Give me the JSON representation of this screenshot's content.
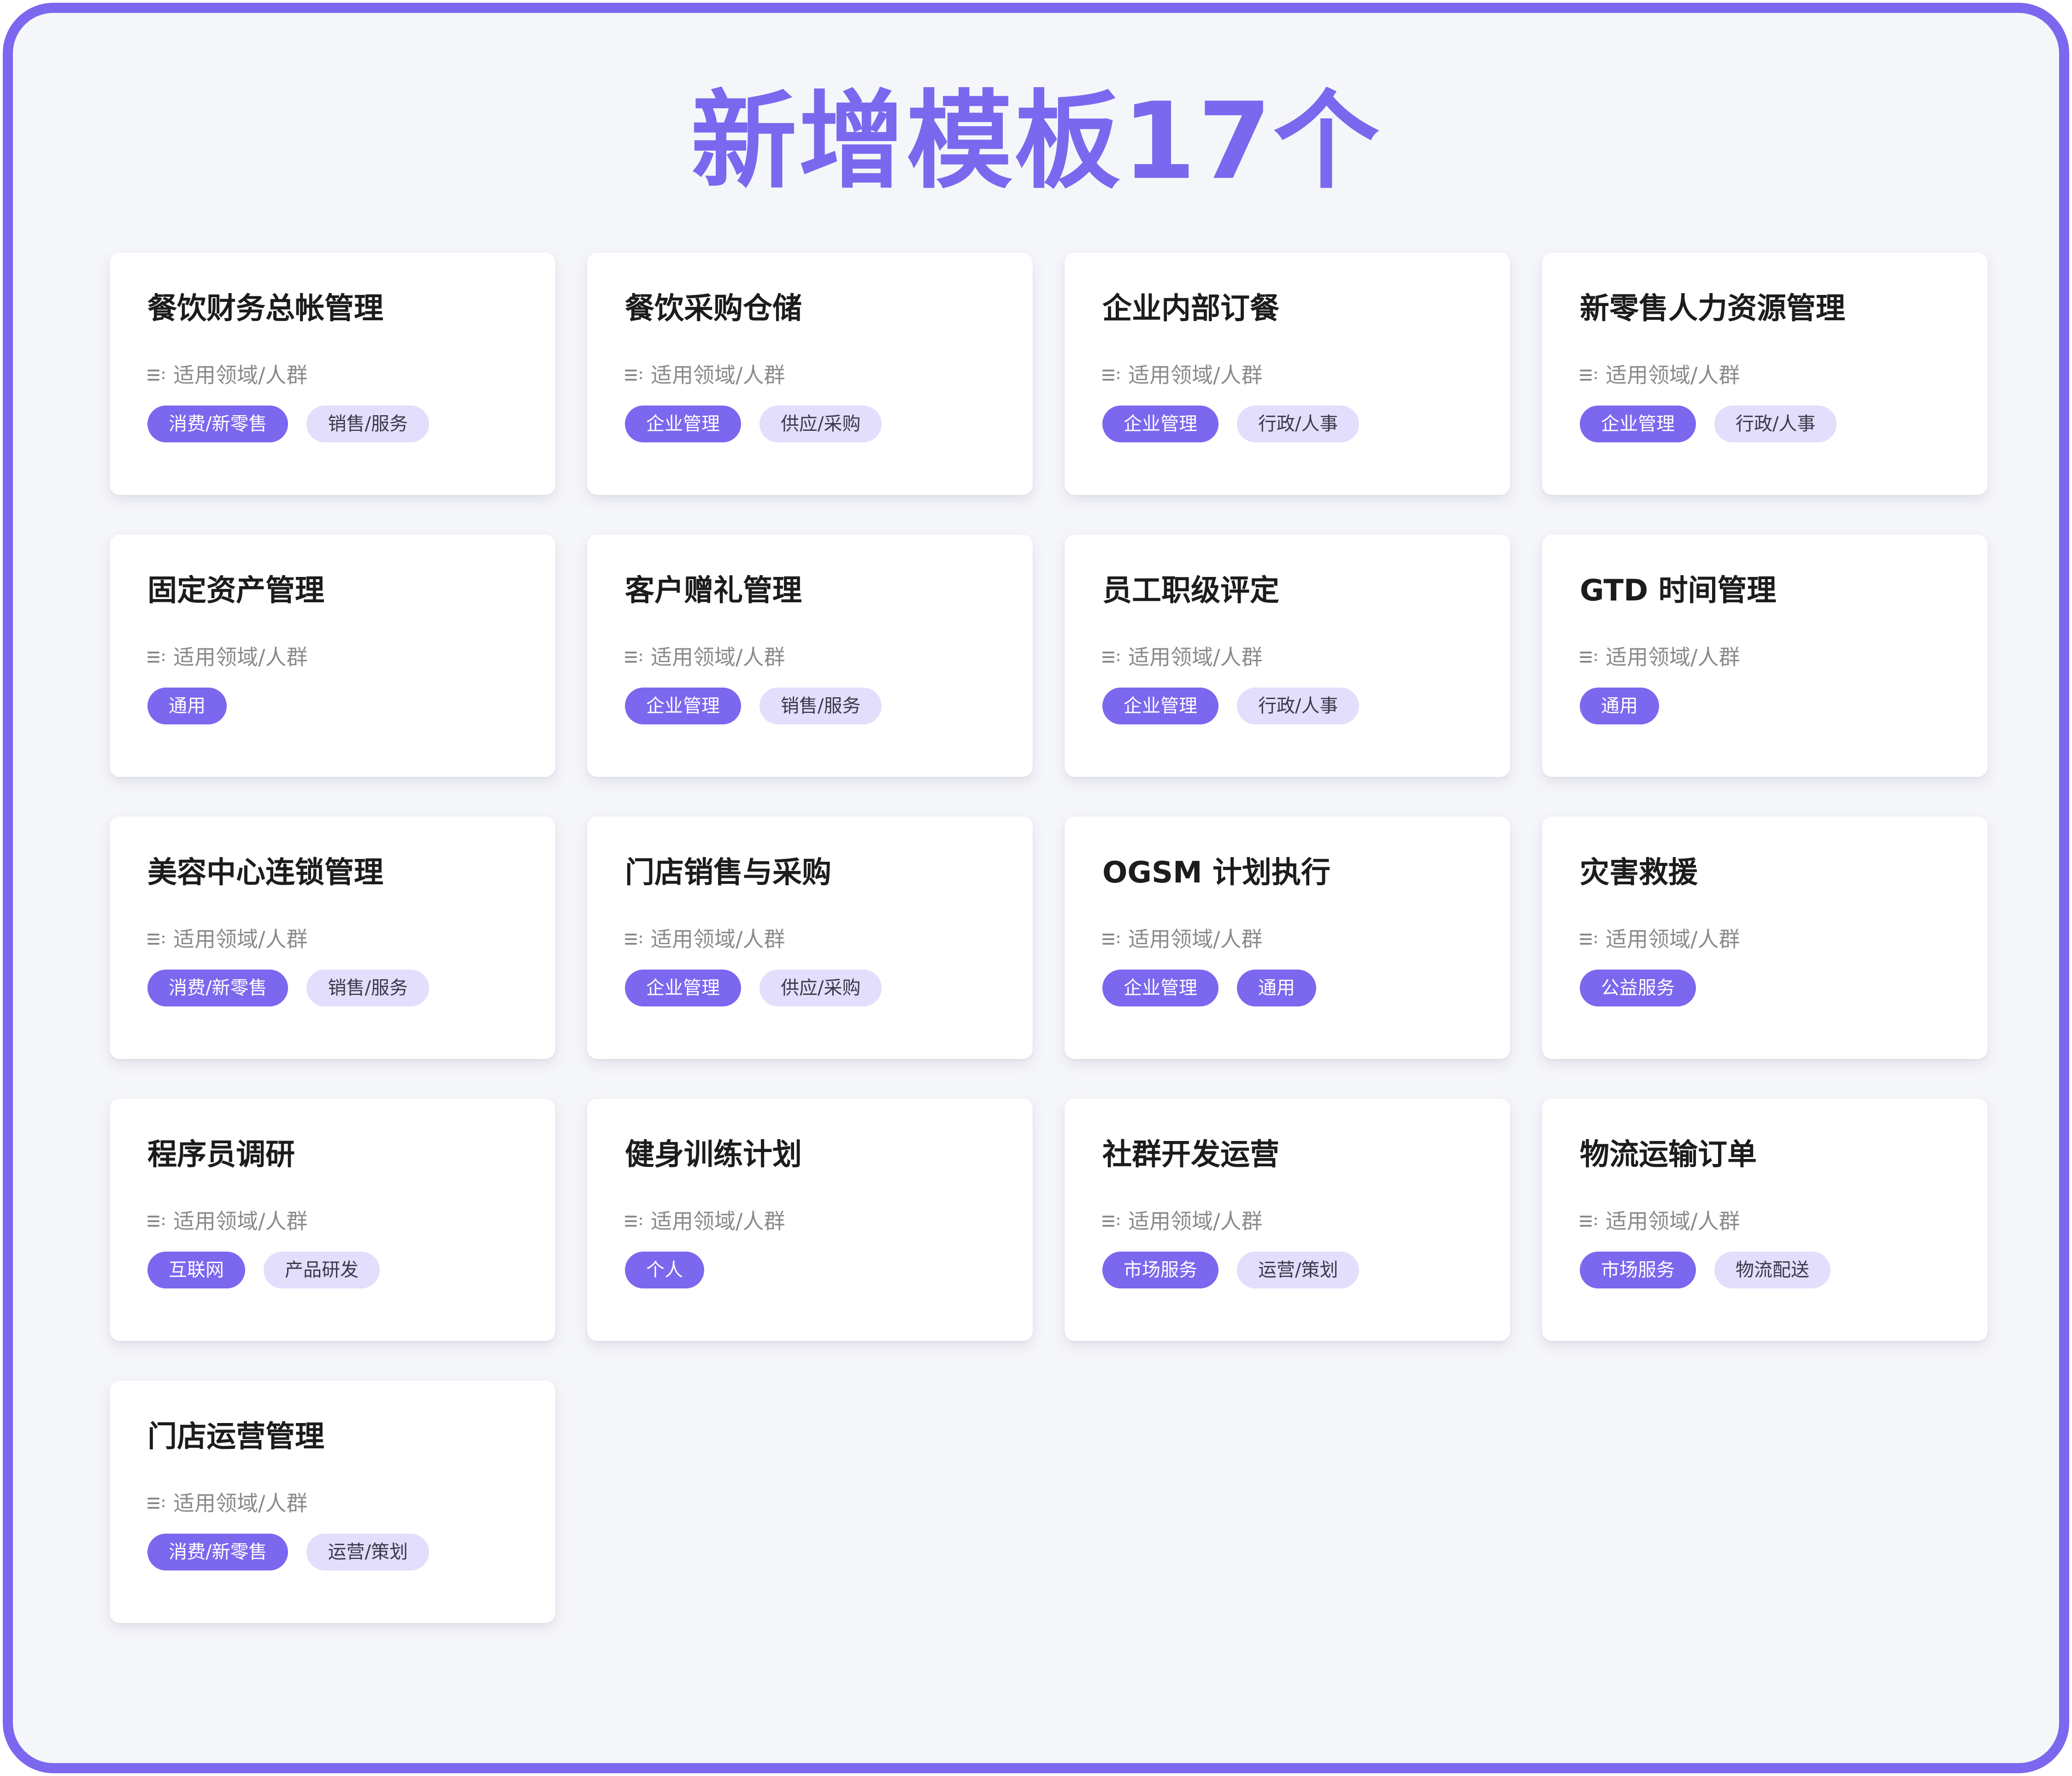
{
  "header": {
    "title": "新增模板17个"
  },
  "meta_label": "适用领域/人群",
  "colors": {
    "accent": "#7b68ee",
    "tag_secondary_bg": "#e2defc",
    "page_bg": "#f5f6fa"
  },
  "icons": {
    "meta": "list-icon"
  },
  "cards": [
    {
      "title": "餐饮财务总帐管理",
      "tags": [
        {
          "label": "消费/新零售",
          "style": "primary"
        },
        {
          "label": "销售/服务",
          "style": "secondary"
        }
      ]
    },
    {
      "title": "餐饮采购仓储",
      "tags": [
        {
          "label": "企业管理",
          "style": "primary"
        },
        {
          "label": "供应/采购",
          "style": "secondary"
        }
      ]
    },
    {
      "title": "企业内部订餐",
      "tags": [
        {
          "label": "企业管理",
          "style": "primary"
        },
        {
          "label": "行政/人事",
          "style": "secondary"
        }
      ]
    },
    {
      "title": "新零售人力资源管理",
      "tags": [
        {
          "label": "企业管理",
          "style": "primary"
        },
        {
          "label": "行政/人事",
          "style": "secondary"
        }
      ]
    },
    {
      "title": "固定资产管理",
      "tags": [
        {
          "label": "通用",
          "style": "primary"
        }
      ]
    },
    {
      "title": "客户赠礼管理",
      "tags": [
        {
          "label": "企业管理",
          "style": "primary"
        },
        {
          "label": "销售/服务",
          "style": "secondary"
        }
      ]
    },
    {
      "title": "员工职级评定",
      "tags": [
        {
          "label": "企业管理",
          "style": "primary"
        },
        {
          "label": "行政/人事",
          "style": "secondary"
        }
      ]
    },
    {
      "title": "GTD 时间管理",
      "tags": [
        {
          "label": "通用",
          "style": "primary"
        }
      ]
    },
    {
      "title": "美容中心连锁管理",
      "tags": [
        {
          "label": "消费/新零售",
          "style": "primary"
        },
        {
          "label": "销售/服务",
          "style": "secondary"
        }
      ]
    },
    {
      "title": "门店销售与采购",
      "tags": [
        {
          "label": "企业管理",
          "style": "primary"
        },
        {
          "label": "供应/采购",
          "style": "secondary"
        }
      ]
    },
    {
      "title": "OGSM 计划执行",
      "tags": [
        {
          "label": "企业管理",
          "style": "primary"
        },
        {
          "label": "通用",
          "style": "primary"
        }
      ]
    },
    {
      "title": "灾害救援",
      "tags": [
        {
          "label": "公益服务",
          "style": "primary"
        }
      ]
    },
    {
      "title": "程序员调研",
      "tags": [
        {
          "label": "互联网",
          "style": "primary"
        },
        {
          "label": "产品研发",
          "style": "secondary"
        }
      ]
    },
    {
      "title": "健身训练计划",
      "tags": [
        {
          "label": "个人",
          "style": "primary"
        }
      ]
    },
    {
      "title": "社群开发运营",
      "tags": [
        {
          "label": "市场服务",
          "style": "primary"
        },
        {
          "label": "运营/策划",
          "style": "secondary"
        }
      ]
    },
    {
      "title": "物流运输订单",
      "tags": [
        {
          "label": "市场服务",
          "style": "primary"
        },
        {
          "label": "物流配送",
          "style": "secondary"
        }
      ]
    },
    {
      "title": "门店运营管理",
      "tags": [
        {
          "label": "消费/新零售",
          "style": "primary"
        },
        {
          "label": "运营/策划",
          "style": "secondary"
        }
      ]
    }
  ]
}
